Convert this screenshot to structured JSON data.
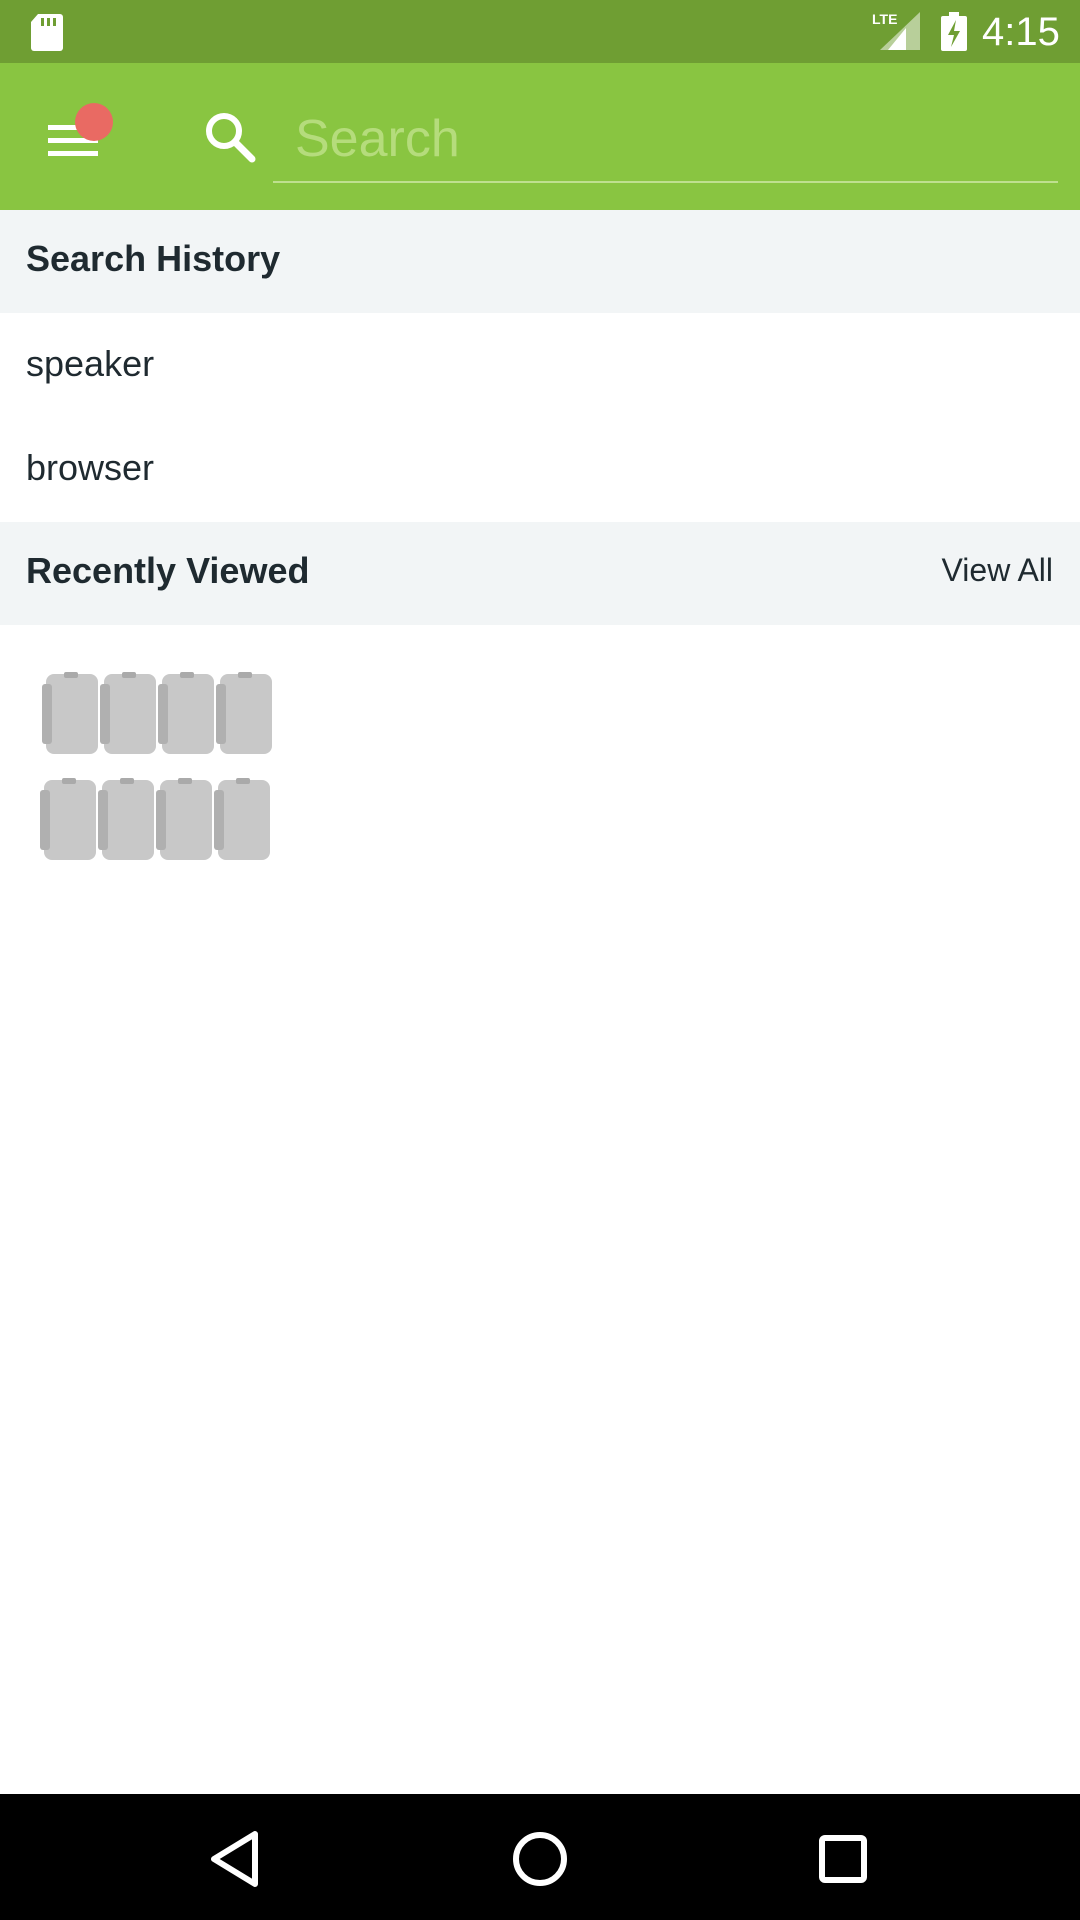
{
  "status_bar": {
    "time": "4:15",
    "network_label": "LTE",
    "icons": [
      "sd-card-icon",
      "lte-signal-icon",
      "battery-charging-icon"
    ]
  },
  "app_bar": {
    "search_placeholder": "Search",
    "search_value": "",
    "accent_color": "#89c541",
    "notification_dot_color": "#e96a63"
  },
  "search_history": {
    "title": "Search History",
    "items": [
      {
        "label": "speaker"
      },
      {
        "label": "browser"
      }
    ]
  },
  "recently_viewed": {
    "title": "Recently Viewed",
    "view_all_label": "View All",
    "items": [
      {
        "icon": "speaker-product-image"
      }
    ]
  },
  "nav_bar": {
    "icons": [
      "back-icon",
      "home-icon",
      "recents-icon"
    ]
  }
}
